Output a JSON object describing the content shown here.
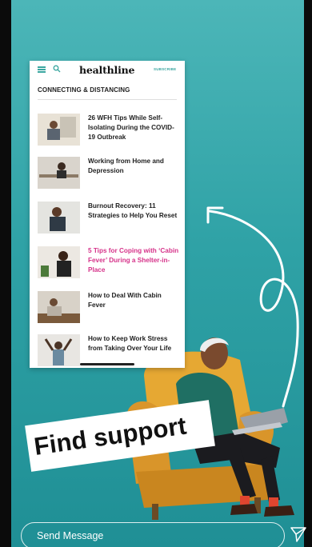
{
  "card": {
    "brand": "healthline",
    "subscribe": "SUBSCRIBE",
    "section_title": "CONNECTING & DISTANCING",
    "articles": [
      {
        "title": "26 WFH Tips While Self-Isolating During the COVID-19 Outbreak",
        "highlight": false
      },
      {
        "title": "Working from Home and Depression",
        "highlight": false
      },
      {
        "title": "Burnout Recovery: 11 Strategies to Help You Reset",
        "highlight": false
      },
      {
        "title": "5 Tips for Coping with ‘Cabin Fever’ During a Shelter-in-Place",
        "highlight": true
      },
      {
        "title": "How to Deal With Cabin Fever",
        "highlight": false
      },
      {
        "title": "How to Keep Work Stress from Taking Over Your Life",
        "highlight": false
      }
    ]
  },
  "sticker": {
    "text": "Find support"
  },
  "composer": {
    "placeholder": "Send Message",
    "send_icon": "send-icon"
  },
  "colors": {
    "brand_teal": "#3aa6a0",
    "highlight_pink": "#d6338a",
    "background_teal": "#2fa2a6"
  }
}
